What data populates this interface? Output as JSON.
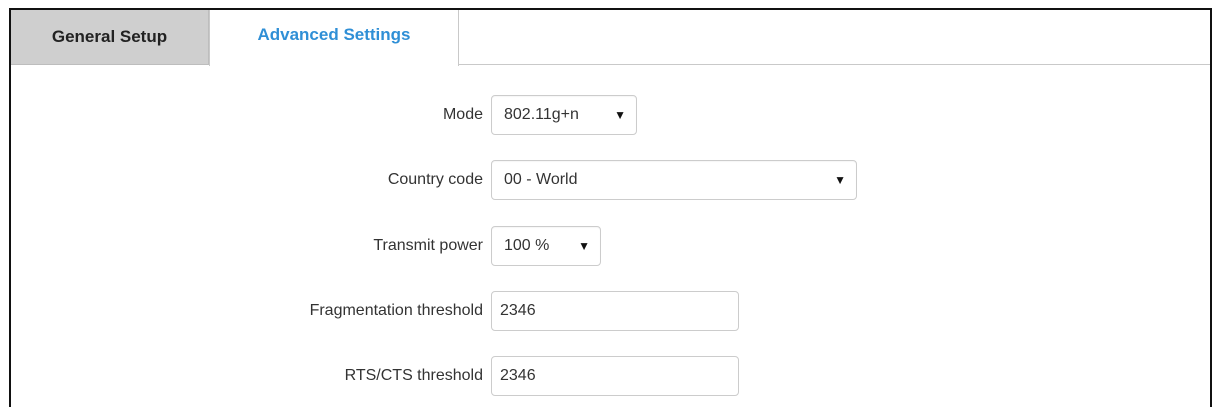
{
  "tabs": [
    {
      "label": "General Setup",
      "active": false
    },
    {
      "label": "Advanced Settings",
      "active": true
    }
  ],
  "colors": {
    "active_tab_text": "#2f8fd6",
    "inactive_tab_bg": "#cfcfcf",
    "field_border": "#cccccc"
  },
  "form": {
    "mode": {
      "label": "Mode",
      "value": "802.11g+n",
      "icon": "dropdown-caret"
    },
    "country_code": {
      "label": "Country code",
      "value": "00 - World",
      "icon": "dropdown-caret"
    },
    "transmit_power": {
      "label": "Transmit power",
      "value": "100 %",
      "icon": "dropdown-caret"
    },
    "fragmentation_threshold": {
      "label": "Fragmentation threshold",
      "value": "2346"
    },
    "rts_cts_threshold": {
      "label": "RTS/CTS threshold",
      "value": "2346"
    }
  },
  "caret_glyph": "▼"
}
